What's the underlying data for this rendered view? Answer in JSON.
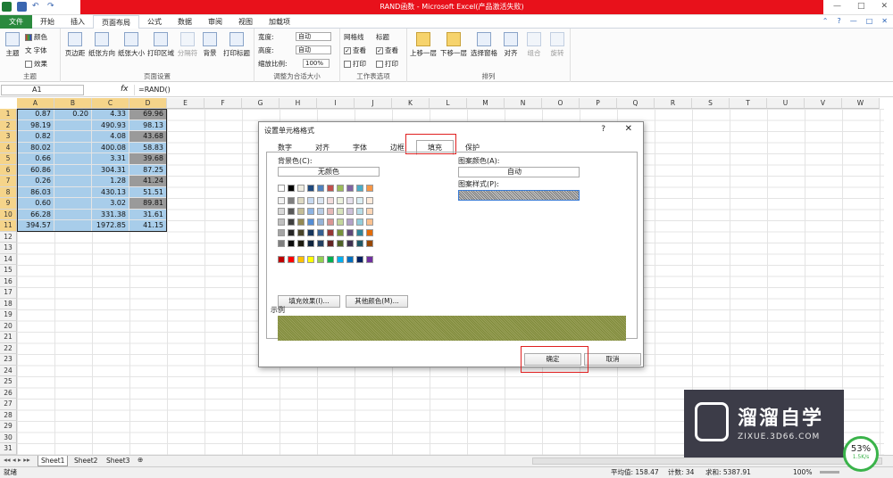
{
  "window": {
    "title": "RAND函数 - Microsoft Excel(产品激活失败)"
  },
  "tabs": [
    "文件",
    "开始",
    "插入",
    "页面布局",
    "公式",
    "数据",
    "审阅",
    "视图",
    "加载项"
  ],
  "active_tab": "页面布局",
  "ribbon": {
    "theme_group": {
      "name": "主题",
      "theme_btn": "主题",
      "colors": "颜色",
      "fonts": "字体",
      "effects": "效果"
    },
    "page_setup": {
      "name": "页面设置",
      "margins": "页边距",
      "orientation": "纸张方向",
      "size": "纸张大小",
      "print_area": "打印区域",
      "breaks": "分隔符",
      "background": "背景",
      "print_titles": "打印标题"
    },
    "scale": {
      "name": "调整为合适大小",
      "width_label": "宽度:",
      "width_val": "自动",
      "height_label": "高度:",
      "height_val": "自动",
      "scale_label": "缩放比例:",
      "scale_val": "100%"
    },
    "sheet_options": {
      "name": "工作表选项",
      "gridlines": "网格线",
      "headings": "标题",
      "view": "查看",
      "print": "打印"
    },
    "arrange": {
      "name": "排列",
      "bring_forward": "上移一层",
      "send_backward": "下移一层",
      "selection_pane": "选择窗格",
      "align": "对齐",
      "group": "组合",
      "rotate": "旋转"
    }
  },
  "formula_bar": {
    "name_box": "A1",
    "fx": "fx",
    "formula": "=RAND()"
  },
  "columns": [
    "A",
    "B",
    "C",
    "D",
    "E",
    "F",
    "G",
    "H",
    "I",
    "J",
    "K",
    "L",
    "M",
    "N",
    "O",
    "P",
    "Q",
    "R",
    "S",
    "T",
    "U",
    "V",
    "W"
  ],
  "rows": [
    "1",
    "2",
    "3",
    "4",
    "5",
    "6",
    "7",
    "8",
    "9",
    "10",
    "11",
    "12",
    "13",
    "14",
    "15",
    "16",
    "17",
    "18",
    "19",
    "20",
    "21",
    "22",
    "23",
    "24",
    "25",
    "26",
    "27",
    "28",
    "29",
    "30",
    "31"
  ],
  "cells": [
    [
      "0.87",
      "0.20",
      "4.33",
      "69.96"
    ],
    [
      "98.19",
      "",
      "490.93",
      "98.13"
    ],
    [
      "0.82",
      "",
      "4.08",
      "43.68"
    ],
    [
      "80.02",
      "",
      "400.08",
      "58.83"
    ],
    [
      "0.66",
      "",
      "3.31",
      "39.68"
    ],
    [
      "60.86",
      "",
      "304.31",
      "87.25"
    ],
    [
      "0.26",
      "",
      "1.28",
      "41.24"
    ],
    [
      "86.03",
      "",
      "430.13",
      "51.51"
    ],
    [
      "0.60",
      "",
      "3.02",
      "89.81"
    ],
    [
      "66.28",
      "",
      "331.38",
      "31.61"
    ],
    [
      "394.57",
      "",
      "1972.85",
      "41.15"
    ]
  ],
  "sheets": [
    "Sheet1",
    "Sheet2",
    "Sheet3"
  ],
  "status": {
    "left": "就绪",
    "average": "平均值: 158.47",
    "count": "计数: 34",
    "sum": "求和: 5387.91",
    "zoom": "100%"
  },
  "dialog": {
    "title": "设置单元格格式",
    "help": "?",
    "close": "✕",
    "tabs": [
      "数字",
      "对齐",
      "字体",
      "边框",
      "填充",
      "保护"
    ],
    "active_tab": "填充",
    "bg_color_label": "背景色(C):",
    "no_color": "无颜色",
    "fill_effects": "填充效果(I)...",
    "more_colors": "其他颜色(M)...",
    "pattern_color_label": "图案颜色(A):",
    "pattern_color_val": "自动",
    "pattern_style_label": "图案样式(P):",
    "sample_label": "示例",
    "ok": "确定",
    "cancel": "取消"
  },
  "watermark": {
    "title": "溜溜自学",
    "url": "ZIXUE.3D66.COM"
  },
  "gauge": {
    "percent": "53%",
    "rate": "1.5K/s"
  },
  "colors": {
    "excel_green": "#2a8a3e",
    "title_red": "#e8111b",
    "highlight_red": "#e02020",
    "sel_blue": "#a8cdea",
    "sel_gray": "#9a9a9a"
  }
}
